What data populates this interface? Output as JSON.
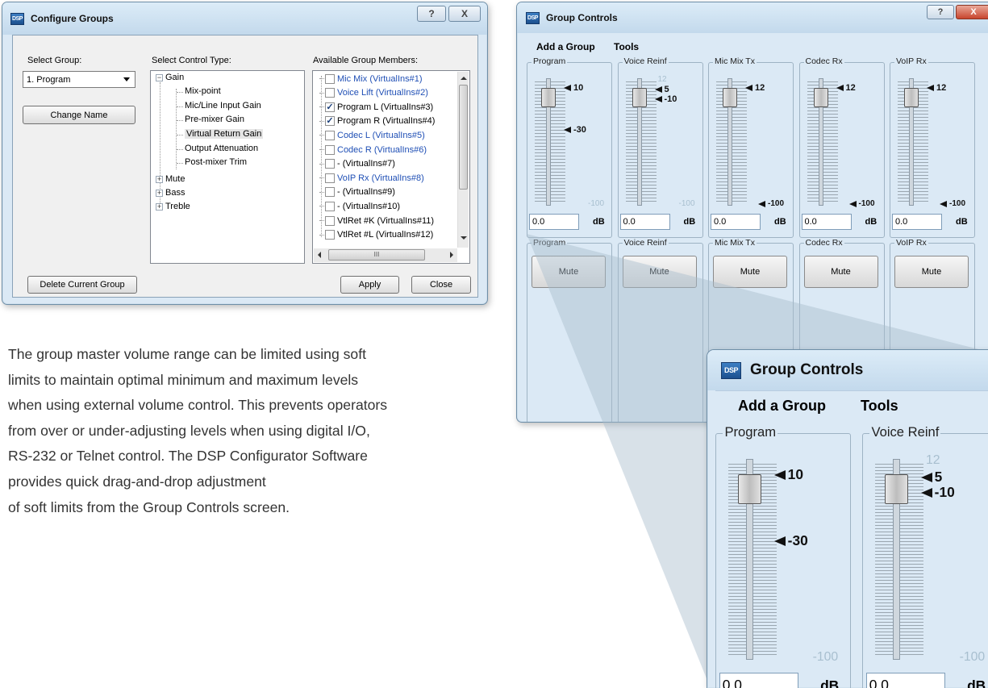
{
  "configure_groups": {
    "title": "Configure Groups",
    "help_glyph": "?",
    "close_glyph": "X",
    "select_group_label": "Select Group:",
    "select_group_value": "1. Program",
    "change_name_label": "Change Name",
    "select_control_type_label": "Select Control Type:",
    "tree": {
      "gain": "Gain",
      "gain_children": [
        "Mix-point",
        "Mic/Line Input Gain",
        "Pre-mixer Gain",
        "Virtual Return Gain",
        "Output Attenuation",
        "Post-mixer Trim"
      ],
      "mute": "Mute",
      "bass": "Bass",
      "treble": "Treble"
    },
    "available_members_label": "Available Group Members:",
    "members": [
      {
        "label": "Mic Mix (VirtualIns#1)",
        "checked": false,
        "blue": true
      },
      {
        "label": "Voice Lift (VirtualIns#2)",
        "checked": false,
        "blue": true
      },
      {
        "label": "Program L (VirtualIns#3)",
        "checked": true,
        "blue": false
      },
      {
        "label": "Program R (VirtualIns#4)",
        "checked": true,
        "blue": false
      },
      {
        "label": "Codec L (VirtualIns#5)",
        "checked": false,
        "blue": true
      },
      {
        "label": "Codec R (VirtualIns#6)",
        "checked": false,
        "blue": true
      },
      {
        "label": "- (VirtualIns#7)",
        "checked": false,
        "blue": false
      },
      {
        "label": "VoIP Rx (VirtualIns#8)",
        "checked": false,
        "blue": true
      },
      {
        "label": "- (VirtualIns#9)",
        "checked": false,
        "blue": false
      },
      {
        "label": "- (VirtualIns#10)",
        "checked": false,
        "blue": false
      },
      {
        "label": "VtlRet #K (VirtualIns#11)",
        "checked": false,
        "blue": false
      },
      {
        "label": "VtlRet #L (VirtualIns#12)",
        "checked": false,
        "blue": false
      }
    ],
    "scroll_thumb_glyph": "III",
    "delete_group_label": "Delete Current Group",
    "apply_label": "Apply",
    "close_label": "Close"
  },
  "description": [
    "The group master volume range can be limited using soft",
    "limits to maintain optimal minimum and maximum levels",
    "when using external volume control. This prevents operators",
    "from over or under-adjusting levels when using digital I/O,",
    "RS-232 or Telnet control. The DSP Configurator Software",
    "provides quick drag-and-drop adjustment",
    "of soft limits from the Group Controls screen."
  ],
  "group_controls": {
    "title": "Group Controls",
    "icon_text": "DSP",
    "menu": [
      "Add a Group",
      "Tools"
    ],
    "channels": [
      {
        "name": "Program",
        "marks": [
          "10",
          "-30"
        ],
        "faint_top": "",
        "faint_bottom": "-100",
        "bottom_mark": "",
        "value": "0.0",
        "unit": "dB",
        "mute": "Mute"
      },
      {
        "name": "Voice Reinf",
        "marks": [
          "5",
          "-10"
        ],
        "faint_top": "12",
        "faint_bottom": "-100",
        "bottom_mark": "",
        "value": "0.0",
        "unit": "dB",
        "mute": "Mute"
      },
      {
        "name": "Mic Mix Tx",
        "marks": [
          "12"
        ],
        "faint_top": "",
        "faint_bottom": "",
        "bottom_mark": "-100",
        "value": "0.0",
        "unit": "dB",
        "mute": "Mute"
      },
      {
        "name": "Codec Rx",
        "marks": [
          "12"
        ],
        "faint_top": "",
        "faint_bottom": "",
        "bottom_mark": "-100",
        "value": "0.0",
        "unit": "dB",
        "mute": "Mute"
      },
      {
        "name": "VoIP Rx",
        "marks": [
          "12"
        ],
        "faint_top": "",
        "faint_bottom": "",
        "bottom_mark": "-100",
        "value": "0.0",
        "unit": "dB",
        "mute": "Mute"
      }
    ]
  },
  "zoom": {
    "title": "Group Controls",
    "icon_text": "DSP",
    "menu": [
      "Add a Group",
      "Tools"
    ],
    "channels": [
      {
        "name": "Program",
        "marks": [
          "10",
          "-30"
        ],
        "faint_top": "",
        "faint_bottom": "-100",
        "value": "0.0",
        "unit": "dB"
      },
      {
        "name": "Voice Reinf",
        "marks": [
          "5",
          "-10"
        ],
        "faint_top": "12",
        "faint_bottom": "-100",
        "value": "0.0",
        "unit": "dB"
      }
    ]
  }
}
